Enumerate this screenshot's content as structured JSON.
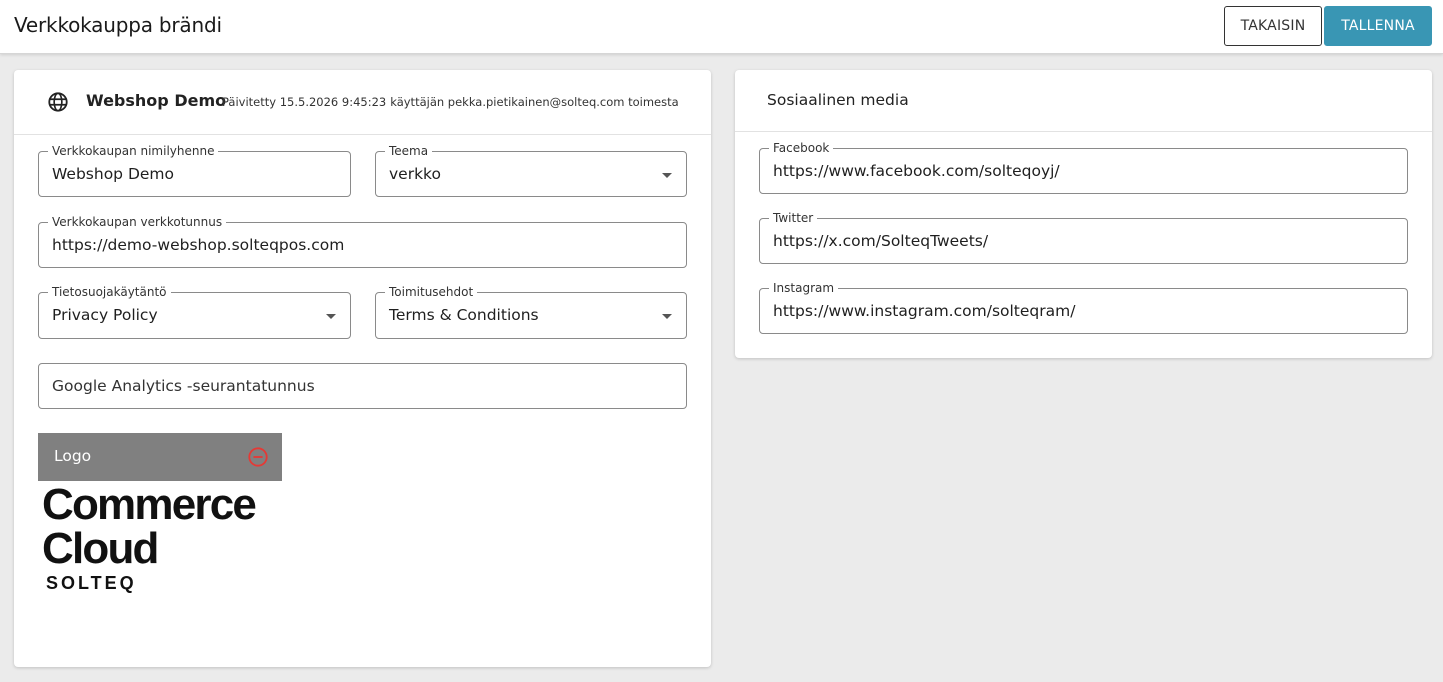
{
  "header": {
    "title": "Verkkokauppa brändi",
    "back_label": "TAKAISIN",
    "save_label": "TALLENNA",
    "save_color": "#3996b4"
  },
  "store_card": {
    "icon": "globe-icon",
    "name": "Webshop Demo",
    "updated_prefix": "Päivitetty 15.5.2026 9:45:23",
    "updated_by": "käyttäjän pekka.pietikainen@solteq.com toimesta",
    "fields": {
      "short_name": {
        "label": "Verkkokaupan nimilyhenne",
        "value": "Webshop Demo"
      },
      "theme": {
        "label": "Teema",
        "value": "verkko"
      },
      "domain": {
        "label": "Verkkokaupan verkkotunnus",
        "value": "https://demo-webshop.solteqpos.com"
      },
      "privacy": {
        "label": "Tietosuojakäytäntö",
        "value": "Privacy Policy"
      },
      "terms": {
        "label": "Toimitusehdot",
        "value": "Terms & Conditions"
      },
      "analytics": {
        "placeholder": "Google Analytics -seurantatunnus"
      }
    },
    "logo": {
      "label": "Logo",
      "remove_icon": "minus-circle-icon",
      "remove_color": "#e53935",
      "image_lines": [
        "Commerce",
        "Cloud",
        "SOLTEQ"
      ]
    }
  },
  "social_card": {
    "title": "Sosiaalinen media",
    "fields": [
      {
        "label": "Facebook",
        "value": "https://www.facebook.com/solteqoyj/"
      },
      {
        "label": "Twitter",
        "value": "https://x.com/SolteqTweets/"
      },
      {
        "label": "Instagram",
        "value": "https://www.instagram.com/solteqram/"
      }
    ]
  }
}
